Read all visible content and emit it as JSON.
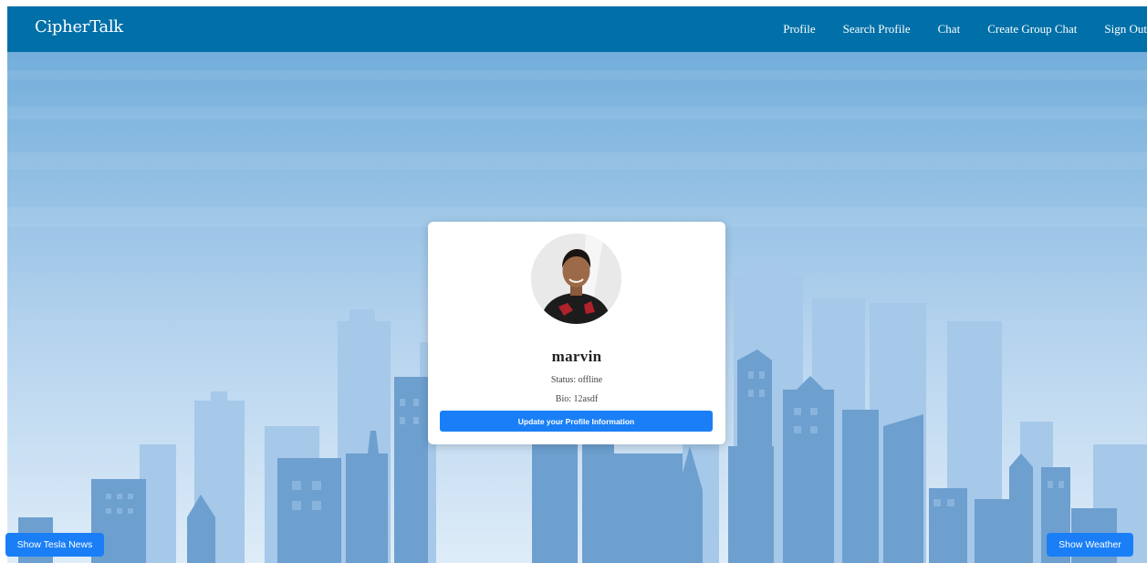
{
  "navbar": {
    "brand": "CipherTalk",
    "links": [
      "Profile",
      "Search Profile",
      "Chat",
      "Create Group Chat",
      "Sign Out"
    ],
    "background": "#0170a8"
  },
  "profile": {
    "username": "marvin",
    "status": "Status: offline",
    "bio": "Bio: 12asdf",
    "update_button": "Update your Profile Information"
  },
  "actions": {
    "tesla_button": "Show Tesla News",
    "weather_button": "Show Weather"
  },
  "colors": {
    "accent": "#1a7ff7",
    "sky_top": "#78b2de",
    "sky_bottom": "#dcebf7"
  }
}
